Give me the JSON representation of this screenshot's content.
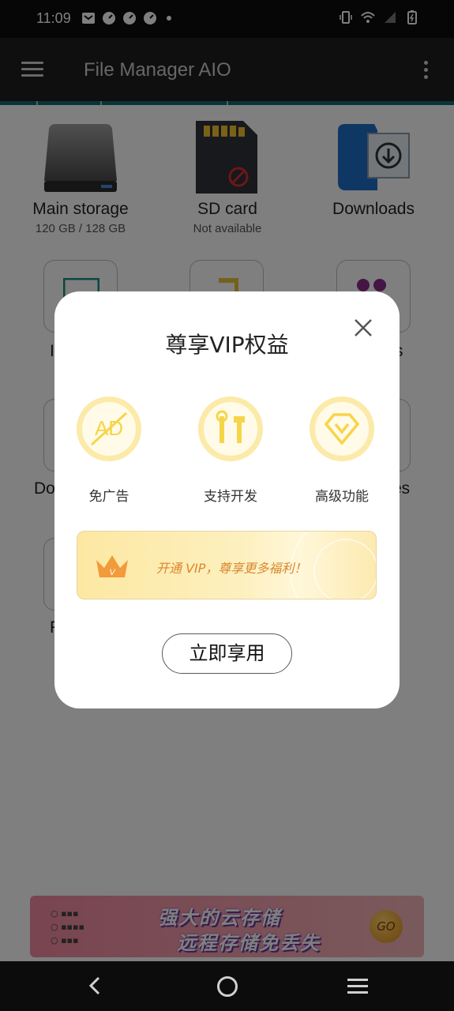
{
  "status_bar": {
    "time": "11:09",
    "left_icons": [
      "mail-icon",
      "speed-icon",
      "speed-icon",
      "speed-icon",
      "dot-icon"
    ],
    "right_icons": [
      "vibrate-icon",
      "wifi-icon",
      "signal-icon",
      "battery-charging-icon"
    ]
  },
  "app_bar": {
    "title": "File Manager AIO",
    "menu_icon": "hamburger-menu-icon",
    "more_icon": "more-vertical-icon"
  },
  "storage": [
    {
      "label": "Main storage",
      "sub": "120 GB / 128 GB",
      "icon": "hard-drive-icon"
    },
    {
      "label": "SD card",
      "sub": "Not available",
      "icon": "sd-card-icon"
    },
    {
      "label": "Downloads",
      "sub": "",
      "icon": "downloads-icon"
    }
  ],
  "partial_labels": {
    "row2_left": "I",
    "row2_right": "s",
    "row3_left": "Do",
    "row3_right": "es",
    "row4_left": "F"
  },
  "dialog": {
    "title": "尊享VIP权益",
    "features": [
      {
        "label": "免广告",
        "icon": "no-ads-icon"
      },
      {
        "label": "支持开发",
        "icon": "tools-icon"
      },
      {
        "label": "高级功能",
        "icon": "vip-diamond-icon"
      }
    ],
    "banner_text": "开通 VIP，尊享更多福利！",
    "button_label": "立即享用",
    "colors": {
      "accent": "#f6d54a",
      "banner_text": "#d9862c"
    }
  },
  "ad_banner": {
    "line1": "强大的云存储",
    "line2": "远程存储免丢失",
    "go_label": "GO"
  },
  "nav_bar": {
    "icons": [
      "back-icon",
      "home-icon",
      "recents-icon"
    ]
  }
}
